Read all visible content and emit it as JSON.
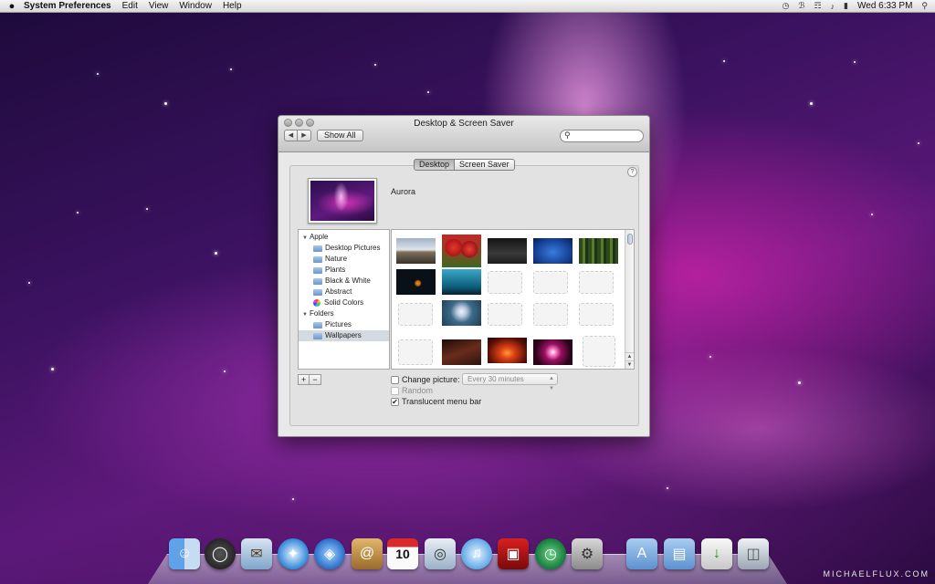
{
  "menubar": {
    "apple": "",
    "app_name": "System Preferences",
    "items": [
      "Edit",
      "View",
      "Window",
      "Help"
    ],
    "clock": "Wed 6:33 PM"
  },
  "window": {
    "title": "Desktop & Screen Saver",
    "back": "◀",
    "forward": "▶",
    "show_all": "Show All",
    "search": {
      "placeholder": "",
      "icon": "search-icon"
    },
    "tabs": [
      "Desktop",
      "Screen Saver"
    ],
    "current_picture_name": "Aurora",
    "help": "?",
    "sources": {
      "apple_group": "Apple",
      "apple_items": [
        "Desktop Pictures",
        "Nature",
        "Plants",
        "Black & White",
        "Abstract",
        "Solid Colors"
      ],
      "folders_group": "Folders",
      "folder_items": [
        "Pictures",
        "Wallpapers"
      ],
      "selected": "Wallpapers"
    },
    "add": "+",
    "remove": "−",
    "change_picture_label": "Change picture:",
    "change_picture_checked": false,
    "interval": "Every 30 minutes",
    "random_label": "Random",
    "random_enabled": false,
    "translucent_label": "Translucent menu bar",
    "translucent_checked": true,
    "checkmark": "✔"
  },
  "dock": [
    "Finder",
    "Dashboard",
    "Mail",
    "Safari",
    "iChat",
    "Address Book",
    "iCal",
    "Preview",
    "iTunes",
    "Photo Booth",
    "Time Machine",
    "System Preferences",
    "Applications",
    "Documents",
    "Downloads",
    "Trash"
  ],
  "watermark": "MICHAELFLUX.COM"
}
